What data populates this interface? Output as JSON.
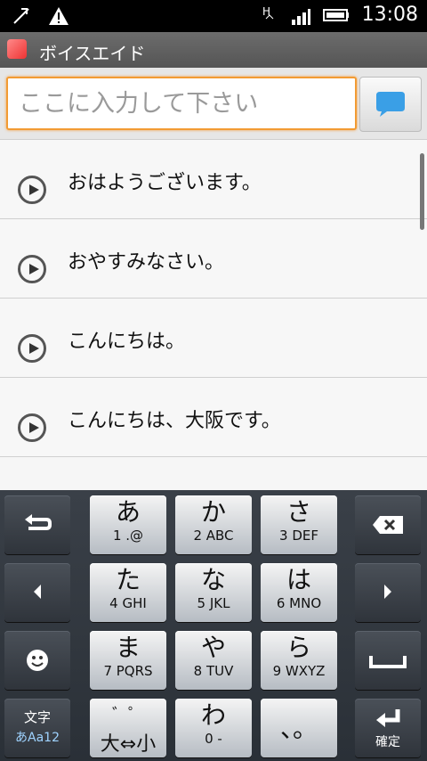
{
  "status": {
    "time": "13:08"
  },
  "app": {
    "title": "ボイスエイド"
  },
  "input": {
    "placeholder": "ここに入力して下さい"
  },
  "phrases": [
    {
      "text": "おはようございます。"
    },
    {
      "text": "おやすみなさい。"
    },
    {
      "text": "こんにちは。"
    },
    {
      "text": "こんにちは、大阪です。"
    }
  ],
  "keyboard": {
    "keys": [
      {
        "main": "あ",
        "sub": "1 .@"
      },
      {
        "main": "か",
        "sub": "2 ABC"
      },
      {
        "main": "さ",
        "sub": "3 DEF"
      },
      {
        "main": "た",
        "sub": "4 GHI"
      },
      {
        "main": "な",
        "sub": "5 JKL"
      },
      {
        "main": "は",
        "sub": "6 MNO"
      },
      {
        "main": "ま",
        "sub": "7 PQRS"
      },
      {
        "main": "や",
        "sub": "8 TUV"
      },
      {
        "main": "ら",
        "sub": "9 WXYZ"
      },
      {
        "main": "゛゜",
        "sub": "大⇔小"
      },
      {
        "main": "わ",
        "sub": "0 -"
      },
      {
        "main": "、。",
        "sub": ""
      }
    ],
    "mode_top": "文字",
    "mode_bottom": "あAa12",
    "confirm": "確定"
  },
  "colors": {
    "accent": "#f29b33",
    "send": "#3a9fe6"
  }
}
